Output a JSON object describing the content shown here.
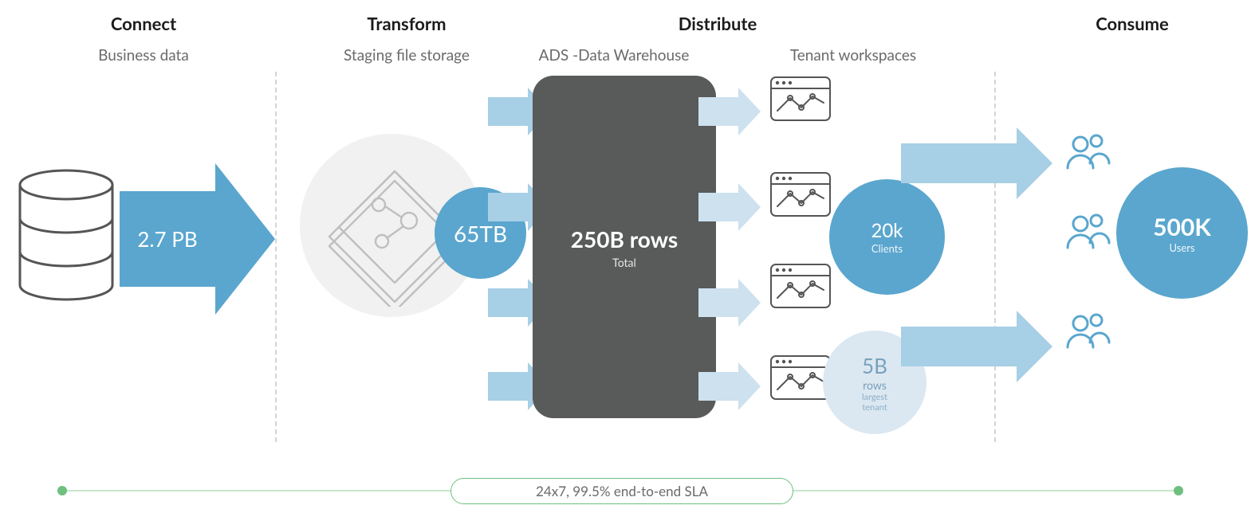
{
  "columns": {
    "connect": {
      "title": "Connect",
      "subtitle": "Business data"
    },
    "transform": {
      "title": "Transform",
      "subtitle": "Staging file storage"
    },
    "distribute": {
      "title": "Distribute",
      "subtitle_left": "ADS -Data Warehouse",
      "subtitle_right": "Tenant workspaces"
    },
    "consume": {
      "title": "Consume"
    }
  },
  "connect": {
    "label": "2.7 PB"
  },
  "transform": {
    "label": "65TB"
  },
  "warehouse": {
    "value": "250B rows",
    "caption": "Total"
  },
  "tenants": {
    "clients": {
      "value": "20k",
      "caption": "Clients"
    },
    "largest": {
      "value": "5B",
      "caption1": "rows",
      "caption2": "largest",
      "caption3": "tenant"
    }
  },
  "consume": {
    "value": "500K",
    "caption": "Users"
  },
  "sla": {
    "text": "24x7, 99.5% end-to-end SLA"
  }
}
